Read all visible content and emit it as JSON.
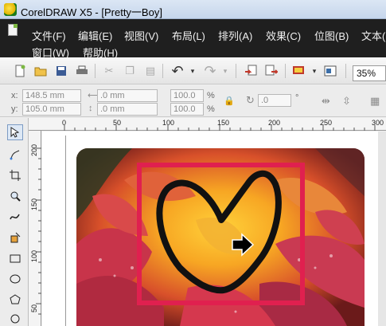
{
  "window": {
    "title": "CorelDRAW X5 - [Pretty一Boy]"
  },
  "menu": {
    "row1": [
      "文件(F)",
      "编辑(E)",
      "视图(V)",
      "布局(L)",
      "排列(A)",
      "效果(C)",
      "位图(B)",
      "文本("
    ],
    "row2": [
      "窗口(W)",
      "帮助(H)"
    ]
  },
  "toolbar": {
    "zoom": "35%"
  },
  "properties": {
    "x_label": "x:",
    "x_value": "148.5 mm",
    "y_label": "y:",
    "y_value": "105.0 mm",
    "w_value": ".0 mm",
    "h_value": ".0 mm",
    "scale_w": "100.0",
    "scale_h": "100.0",
    "percent": "%",
    "angle": ".0",
    "degree": "°"
  },
  "ruler_top": {
    "labels": [
      "0",
      "50",
      "100",
      "150",
      "200",
      "250",
      "300"
    ]
  },
  "ruler_left": {
    "labels": [
      "200",
      "150",
      "100",
      "50"
    ]
  },
  "icons": {
    "title": "coreldraw-icon",
    "document": "document-icon"
  },
  "colors": {
    "menu_bg": "#1f1f1f",
    "frame": "#e0204f",
    "heart": "#111111"
  }
}
